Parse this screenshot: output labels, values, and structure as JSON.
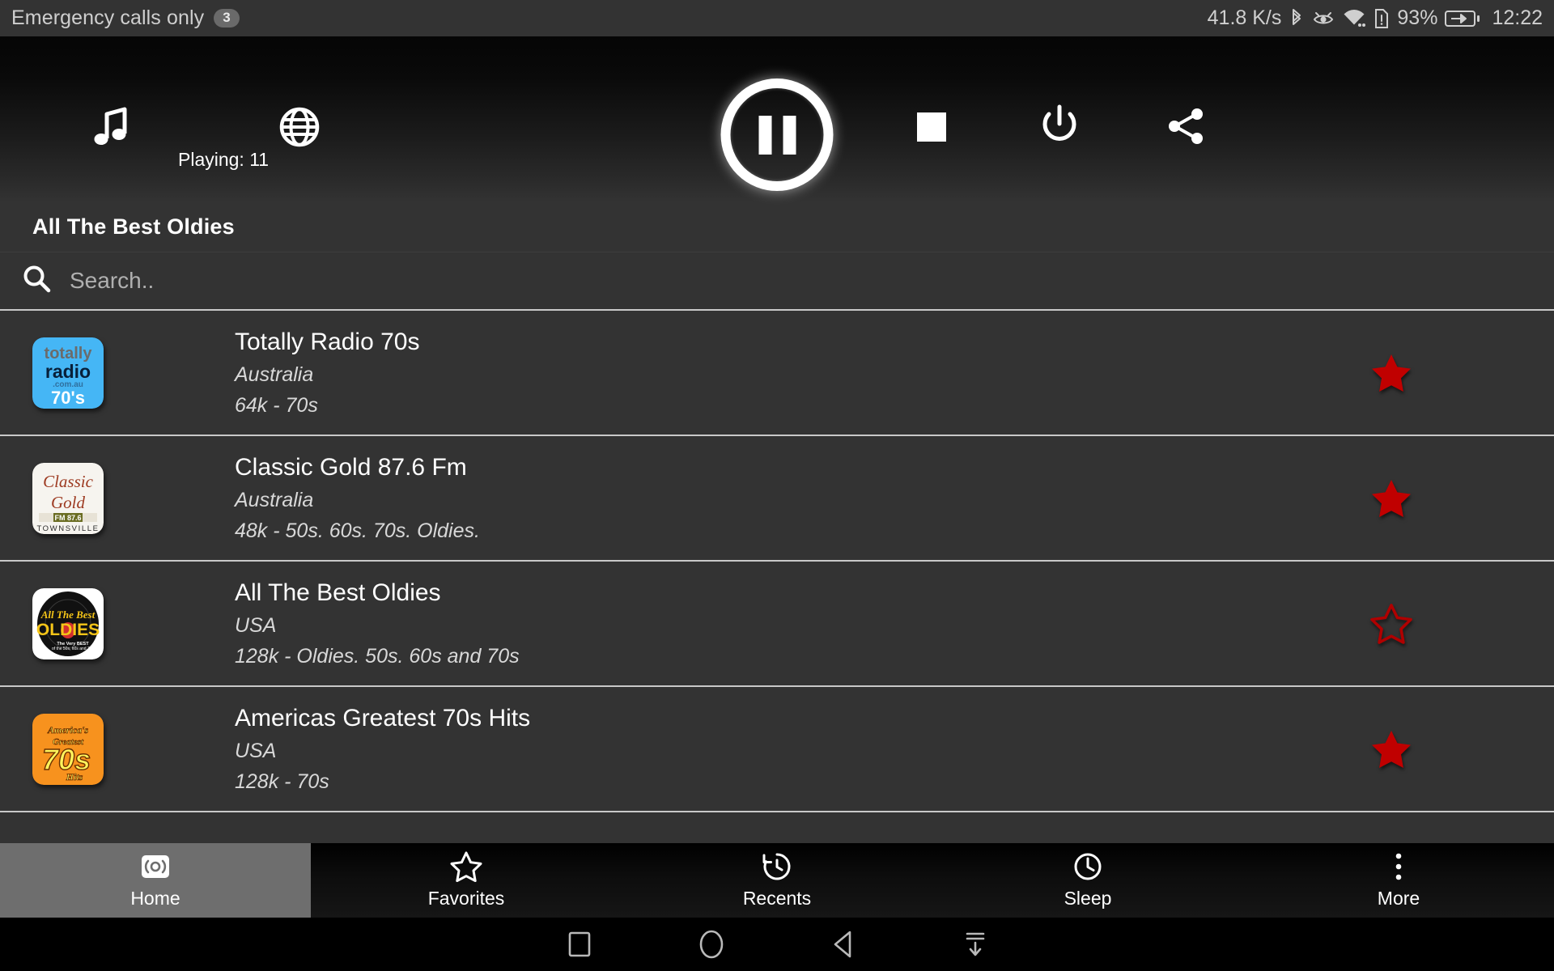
{
  "status_bar": {
    "carrier": "Emergency calls only",
    "notification_count": "3",
    "network_speed": "41.8 K/s",
    "battery_percent": "93%",
    "clock": "12:22",
    "icons": [
      "bluetooth-icon",
      "eye-icon",
      "wifi-icon",
      "sim-alert-icon",
      "battery-charging-icon"
    ]
  },
  "player": {
    "music_icon": "music-note-icon",
    "globe_icon": "globe-icon",
    "playing_label": "Playing: 11",
    "transport_button": "pause-icon",
    "stop_icon": "stop-icon",
    "power_icon": "power-icon",
    "share_icon": "share-icon"
  },
  "now_playing": {
    "title": "All The Best Oldies"
  },
  "search": {
    "icon": "search-icon",
    "placeholder": "Search..",
    "value": ""
  },
  "stations": [
    {
      "name": "Totally Radio 70s",
      "country": "Australia",
      "details": "64k - 70s",
      "favorite": true,
      "logo": "totally-radio-70s-logo"
    },
    {
      "name": "Classic Gold 87.6 Fm",
      "country": "Australia",
      "details": "48k - 50s. 60s. 70s. Oldies.",
      "favorite": true,
      "logo": "classic-gold-logo"
    },
    {
      "name": "All The Best Oldies",
      "country": "USA",
      "details": "128k - Oldies. 50s. 60s and 70s",
      "favorite": false,
      "logo": "all-the-best-oldies-logo"
    },
    {
      "name": "Americas Greatest 70s Hits",
      "country": "USA",
      "details": "128k - 70s",
      "favorite": true,
      "logo": "americas-greatest-70s-hits-logo"
    }
  ],
  "tabs": [
    {
      "label": "Home",
      "icon": "radio-broadcast-icon",
      "active": true
    },
    {
      "label": "Favorites",
      "icon": "star-outline-icon",
      "active": false
    },
    {
      "label": "Recents",
      "icon": "history-icon",
      "active": false
    },
    {
      "label": "Sleep",
      "icon": "clock-icon",
      "active": false
    },
    {
      "label": "More",
      "icon": "overflow-dots-icon",
      "active": false
    }
  ],
  "nav_bar": {
    "buttons": [
      "recents-square-icon",
      "home-circle-icon",
      "back-triangle-icon",
      "hide-keyboard-icon"
    ]
  },
  "colors": {
    "favorite_star": "#c00000",
    "row_background": "#333333",
    "divider": "#c9c9c9",
    "active_tab": "#6e6e6e"
  }
}
